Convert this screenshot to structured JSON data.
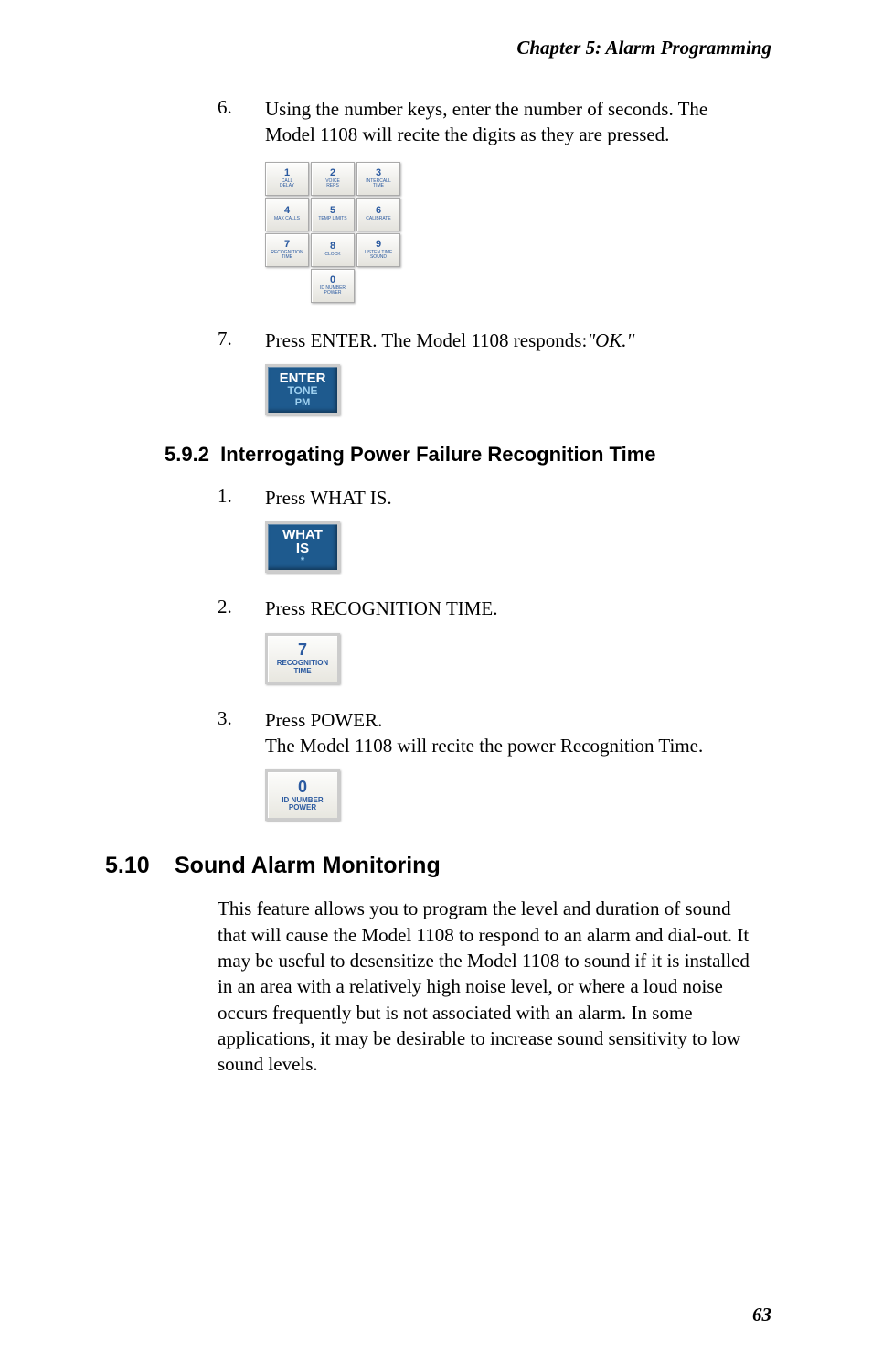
{
  "chapter_header": "Chapter  5:  Alarm Programming",
  "step6": {
    "num": "6.",
    "text": "Using the number keys, enter the number of seconds. The Model 1108 will recite the digits as they are pressed."
  },
  "keypad": {
    "keys": [
      [
        {
          "d": "1",
          "l": "CALL\nDELAY"
        },
        {
          "d": "2",
          "l": "VOICE\nREPS"
        },
        {
          "d": "3",
          "l": "INTERCALL\nTIME"
        }
      ],
      [
        {
          "d": "4",
          "l": "MAX CALLS"
        },
        {
          "d": "5",
          "l": "TEMP LIMITS"
        },
        {
          "d": "6",
          "l": "CALIBRATE"
        }
      ],
      [
        {
          "d": "7",
          "l": "RECOGNITION\nTIME"
        },
        {
          "d": "8",
          "l": "CLOCK"
        },
        {
          "d": "9",
          "l": "LISTEN TIME\nSOUND"
        }
      ],
      [
        {
          "d": "0",
          "l": "ID NUMBER\nPOWER"
        }
      ]
    ]
  },
  "step7": {
    "num": "7.",
    "text_a": "Press ENTER. The Model 1108 responds:",
    "text_b": "\"OK.\""
  },
  "enter_key": {
    "line1": "ENTER",
    "line2": "TONE",
    "line3": "PM"
  },
  "subsection": {
    "num": "5.9.2",
    "title": "Interrogating Power Failure Recognition Time"
  },
  "sub_step1": {
    "num": "1.",
    "text": "Press WHAT IS."
  },
  "whatis_key": {
    "line1": "WHAT",
    "line2": "IS",
    "line3": "*"
  },
  "sub_step2": {
    "num": "2.",
    "text": "Press RECOGNITION TIME."
  },
  "key7": {
    "digit": "7",
    "label1": "RECOGNITION",
    "label2": "TIME"
  },
  "sub_step3": {
    "num": "3.",
    "text_a": "Press POWER.",
    "text_b": "The Model 1108 will recite the power Recognition Time."
  },
  "key0": {
    "digit": "0",
    "label1": "ID NUMBER",
    "label2": "POWER"
  },
  "section": {
    "num": "5.10",
    "title": "Sound Alarm Monitoring"
  },
  "body": "This feature allows you to program the level and duration of sound that will cause the Model 1108 to respond to an alarm and dial-out. It may be useful to desensitize the Model 1108 to sound if it is installed in an area with a relatively high noise level, or where a loud noise occurs frequently but is not associated with an alarm. In some applications, it may be desirable to increase sound sensitivity to low sound levels.",
  "page_number": "63"
}
